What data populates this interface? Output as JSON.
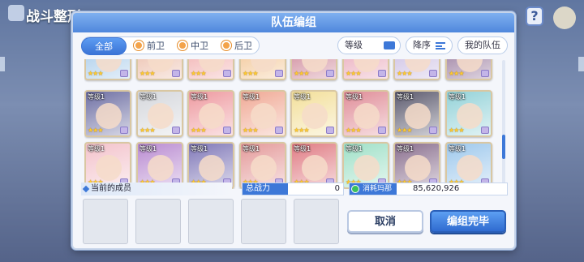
{
  "background": {
    "title": "战斗整形",
    "help_icon": "question-icon",
    "help_label": "?"
  },
  "dialog": {
    "title": "队伍编组"
  },
  "filters": {
    "tabs": [
      {
        "label": "全部",
        "icon": null,
        "active": true
      },
      {
        "label": "前卫",
        "icon": "position-icon",
        "active": false
      },
      {
        "label": "中卫",
        "icon": "position-icon",
        "active": false
      },
      {
        "label": "后卫",
        "icon": "position-icon",
        "active": false
      }
    ],
    "sort_field": "等级",
    "sort_order": "降序",
    "my_team": "我的队伍"
  },
  "roster": {
    "level_label": "等级1",
    "rows": [
      {
        "cards": [
          {
            "stars": "★★★",
            "color": "#9fc6e8"
          },
          {
            "stars": "★★★",
            "color": "#e9b7a2"
          },
          {
            "stars": "★★★",
            "color": "#f0a7a7"
          },
          {
            "stars": "★★★",
            "color": "#f1c08a"
          },
          {
            "stars": "★★★",
            "color": "#c97a8e"
          },
          {
            "stars": "★★★",
            "color": "#e7a0b3"
          },
          {
            "stars": "★★★",
            "color": "#c6b7e0"
          },
          {
            "stars": "★★★",
            "color": "#8d6b92"
          }
        ]
      },
      {
        "cards": [
          {
            "stars": "★★★",
            "color": "#6e6fa3"
          },
          {
            "stars": "★★★",
            "color": "#d5d7dc"
          },
          {
            "stars": "★★★",
            "color": "#ee9aa0"
          },
          {
            "stars": "★★★",
            "color": "#f0a995"
          },
          {
            "stars": "★★★",
            "color": "#f3df9a"
          },
          {
            "stars": "★★★",
            "color": "#e08d98"
          },
          {
            "stars": "★★★",
            "color": "#5c5a6e"
          },
          {
            "stars": "★★★",
            "color": "#93d2d8"
          }
        ]
      },
      {
        "cards": [
          {
            "stars": "★★★",
            "color": "#f3c2cb"
          },
          {
            "stars": "★★★",
            "color": "#b98bd1"
          },
          {
            "stars": "★★★",
            "color": "#8078b8"
          },
          {
            "stars": "★★★",
            "color": "#e49a9a"
          },
          {
            "stars": "★★★",
            "color": "#e07c84"
          },
          {
            "stars": "★★★",
            "color": "#9fe0c7"
          },
          {
            "stars": "★★★",
            "color": "#8a6f8e"
          },
          {
            "stars": "★★★",
            "color": "#9dc8ec"
          }
        ]
      }
    ]
  },
  "members": {
    "label": "当前的成员",
    "power_label": "总战力",
    "power_value": "0",
    "mana_label": "消耗玛那",
    "mana_value": "85,620,926"
  },
  "buttons": {
    "cancel": "取消",
    "done": "编组完毕"
  }
}
